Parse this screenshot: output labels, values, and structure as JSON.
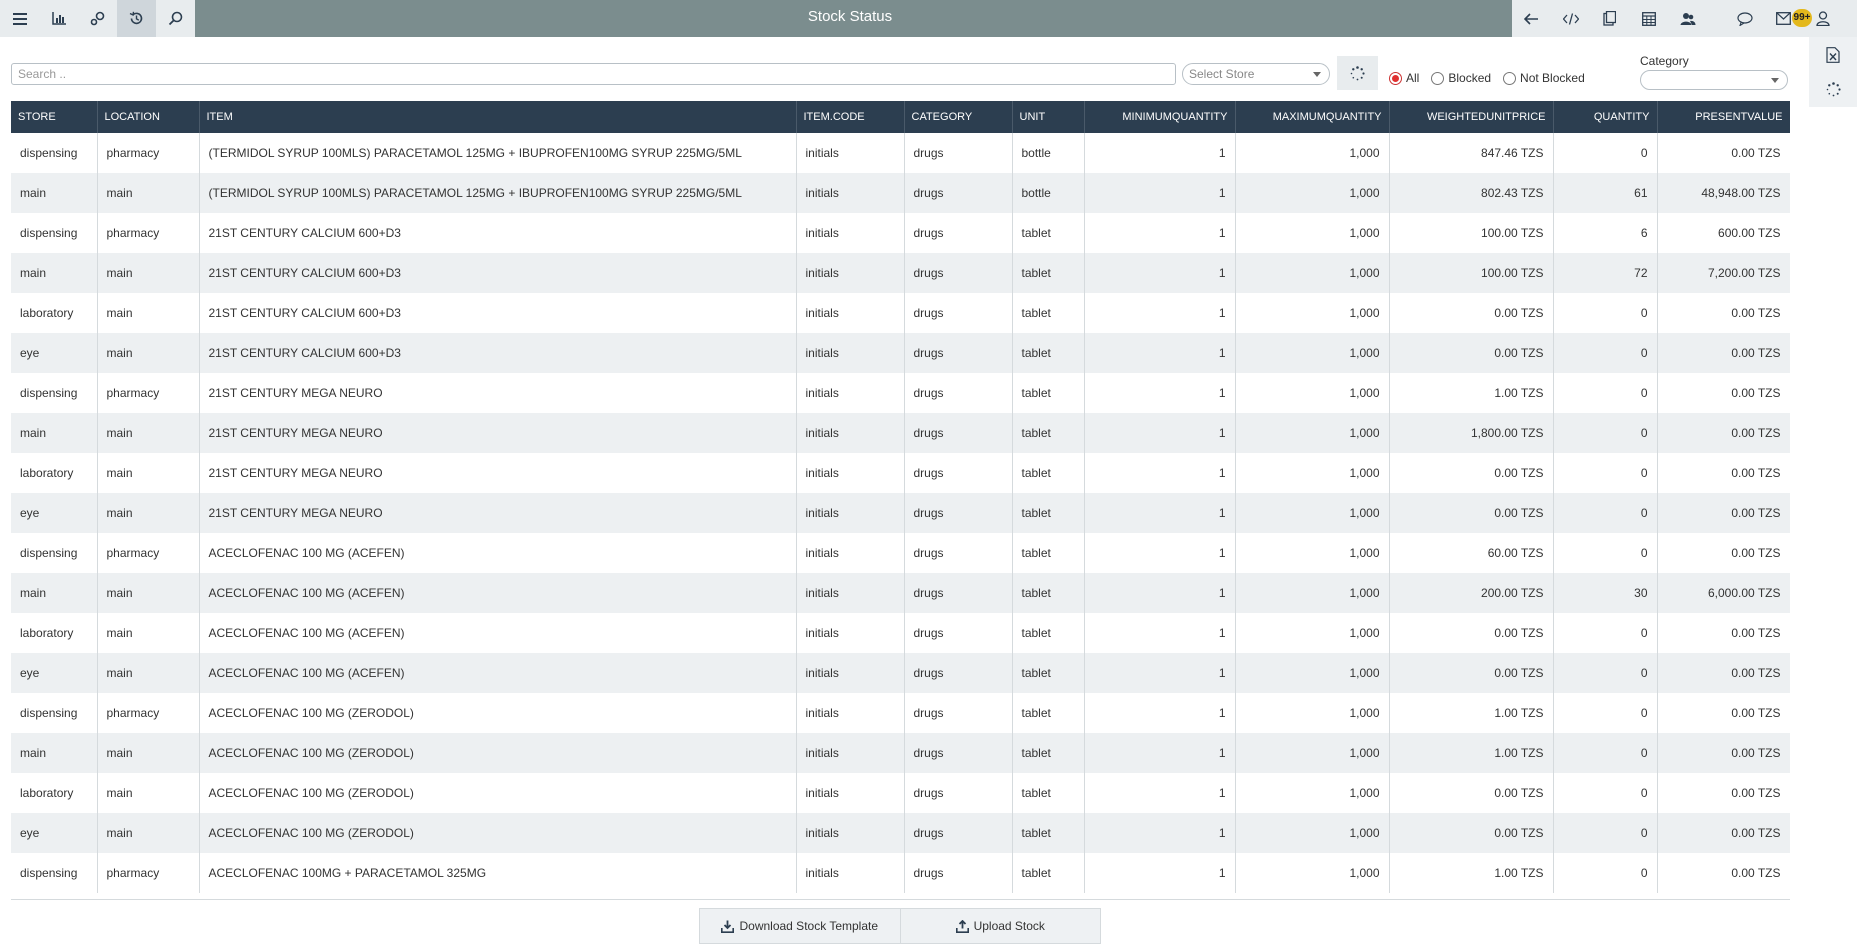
{
  "header": {
    "title": "Stock Status",
    "notification_count": "99+",
    "left_icons": [
      "menu-icon",
      "bar-chart-icon",
      "settings-icon",
      "history-icon",
      "search-icon"
    ],
    "right_icons": [
      "back-arrow-icon",
      "code-icon",
      "clipboard-icon",
      "calculator-icon",
      "users-icon",
      "chat-icon",
      "mail-icon",
      "user-icon"
    ]
  },
  "side_strip": [
    "excel-export-icon",
    "loading-icon"
  ],
  "filters": {
    "search_placeholder": "Search ..",
    "store_placeholder": "Select Store",
    "radio_options": [
      "All",
      "Blocked",
      "Not Blocked"
    ],
    "radio_selected": "All",
    "category_label": "Category",
    "category_value": ""
  },
  "table": {
    "columns": [
      "STORE",
      "LOCATION",
      "ITEM",
      "ITEM.CODE",
      "CATEGORY",
      "UNIT",
      "MINIMUMQUANTITY",
      "MAXIMUMQUANTITY",
      "WEIGHTEDUNITPRICE",
      "QUANTITY",
      "PRESENTVALUE"
    ],
    "rows": [
      [
        "dispensing",
        "pharmacy",
        "(TERMIDOL SYRUP 100MLS) PARACETAMOL 125MG + IBUPROFEN100MG SYRUP 225MG/5ML",
        "initials",
        "drugs",
        "bottle",
        "1",
        "1,000",
        "847.46 TZS",
        "0",
        "0.00 TZS"
      ],
      [
        "main",
        "main",
        "(TERMIDOL SYRUP 100MLS) PARACETAMOL 125MG + IBUPROFEN100MG SYRUP 225MG/5ML",
        "initials",
        "drugs",
        "bottle",
        "1",
        "1,000",
        "802.43 TZS",
        "61",
        "48,948.00 TZS"
      ],
      [
        "dispensing",
        "pharmacy",
        "21ST CENTURY CALCIUM 600+D3",
        "initials",
        "drugs",
        "tablet",
        "1",
        "1,000",
        "100.00 TZS",
        "6",
        "600.00 TZS"
      ],
      [
        "main",
        "main",
        "21ST CENTURY CALCIUM 600+D3",
        "initials",
        "drugs",
        "tablet",
        "1",
        "1,000",
        "100.00 TZS",
        "72",
        "7,200.00 TZS"
      ],
      [
        "laboratory",
        "main",
        "21ST CENTURY CALCIUM 600+D3",
        "initials",
        "drugs",
        "tablet",
        "1",
        "1,000",
        "0.00 TZS",
        "0",
        "0.00 TZS"
      ],
      [
        "eye",
        "main",
        "21ST CENTURY CALCIUM 600+D3",
        "initials",
        "drugs",
        "tablet",
        "1",
        "1,000",
        "0.00 TZS",
        "0",
        "0.00 TZS"
      ],
      [
        "dispensing",
        "pharmacy",
        "21ST CENTURY MEGA NEURO",
        "initials",
        "drugs",
        "tablet",
        "1",
        "1,000",
        "1.00 TZS",
        "0",
        "0.00 TZS"
      ],
      [
        "main",
        "main",
        "21ST CENTURY MEGA NEURO",
        "initials",
        "drugs",
        "tablet",
        "1",
        "1,000",
        "1,800.00 TZS",
        "0",
        "0.00 TZS"
      ],
      [
        "laboratory",
        "main",
        "21ST CENTURY MEGA NEURO",
        "initials",
        "drugs",
        "tablet",
        "1",
        "1,000",
        "0.00 TZS",
        "0",
        "0.00 TZS"
      ],
      [
        "eye",
        "main",
        "21ST CENTURY MEGA NEURO",
        "initials",
        "drugs",
        "tablet",
        "1",
        "1,000",
        "0.00 TZS",
        "0",
        "0.00 TZS"
      ],
      [
        "dispensing",
        "pharmacy",
        "ACECLOFENAC 100 MG (ACEFEN)",
        "initials",
        "drugs",
        "tablet",
        "1",
        "1,000",
        "60.00 TZS",
        "0",
        "0.00 TZS"
      ],
      [
        "main",
        "main",
        "ACECLOFENAC 100 MG (ACEFEN)",
        "initials",
        "drugs",
        "tablet",
        "1",
        "1,000",
        "200.00 TZS",
        "30",
        "6,000.00 TZS"
      ],
      [
        "laboratory",
        "main",
        "ACECLOFENAC 100 MG (ACEFEN)",
        "initials",
        "drugs",
        "tablet",
        "1",
        "1,000",
        "0.00 TZS",
        "0",
        "0.00 TZS"
      ],
      [
        "eye",
        "main",
        "ACECLOFENAC 100 MG (ACEFEN)",
        "initials",
        "drugs",
        "tablet",
        "1",
        "1,000",
        "0.00 TZS",
        "0",
        "0.00 TZS"
      ],
      [
        "dispensing",
        "pharmacy",
        "ACECLOFENAC 100 MG (ZERODOL)",
        "initials",
        "drugs",
        "tablet",
        "1",
        "1,000",
        "1.00 TZS",
        "0",
        "0.00 TZS"
      ],
      [
        "main",
        "main",
        "ACECLOFENAC 100 MG (ZERODOL)",
        "initials",
        "drugs",
        "tablet",
        "1",
        "1,000",
        "1.00 TZS",
        "0",
        "0.00 TZS"
      ],
      [
        "laboratory",
        "main",
        "ACECLOFENAC 100 MG (ZERODOL)",
        "initials",
        "drugs",
        "tablet",
        "1",
        "1,000",
        "0.00 TZS",
        "0",
        "0.00 TZS"
      ],
      [
        "eye",
        "main",
        "ACECLOFENAC 100 MG (ZERODOL)",
        "initials",
        "drugs",
        "tablet",
        "1",
        "1,000",
        "0.00 TZS",
        "0",
        "0.00 TZS"
      ],
      [
        "dispensing",
        "pharmacy",
        "ACECLOFENAC 100MG + PARACETAMOL 325MG",
        "initials",
        "drugs",
        "tablet",
        "1",
        "1,000",
        "1.00 TZS",
        "0",
        "0.00 TZS"
      ]
    ]
  },
  "footer": {
    "download_label": "Download Stock Template",
    "upload_label": "Upload Stock"
  },
  "colors": {
    "topbar": "#7b8d8e",
    "table_header": "#2c3e50",
    "radio_selected": "#e03030",
    "badge": "#e3b81c"
  }
}
